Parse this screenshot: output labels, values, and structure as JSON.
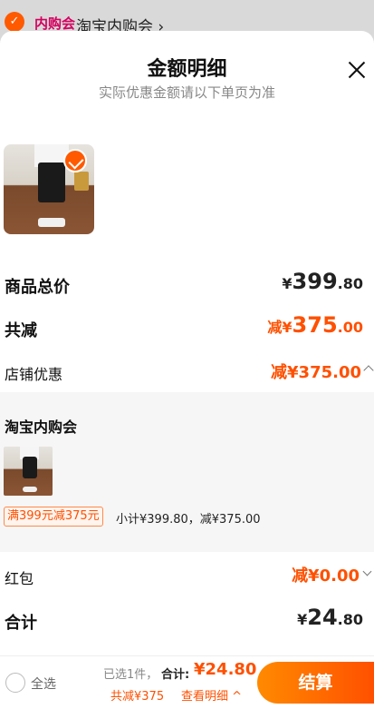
{
  "background": {
    "brand": "内购会",
    "store": "淘宝内购会 ›"
  },
  "sheet": {
    "title": "金额明细",
    "subtitle": "实际优惠金额请以下单页为准",
    "close_icon": "close-icon"
  },
  "summary": {
    "goods_total_label": "商品总价",
    "goods_total_yen": "¥",
    "goods_total_int": "399",
    "goods_total_dec": ".80",
    "total_reduce_label": "共减",
    "total_reduce_prefix": "减¥",
    "total_reduce_int": "375",
    "total_reduce_dec": ".00",
    "shop_discount_label": "店铺优惠",
    "shop_discount_value": "减¥375.00"
  },
  "shop": {
    "name": "淘宝内购会",
    "promo_tag": "满399元减375元",
    "subtotal": "小计¥399.80，减¥375.00"
  },
  "red_packet": {
    "label": "红包",
    "value": "减¥0.00"
  },
  "grand_total": {
    "label": "合计",
    "yen": "¥",
    "int": "24",
    "dec": ".80"
  },
  "bottom_bar": {
    "select_all": "全选",
    "selected_count": "已选1件，",
    "total_label": "合计:",
    "total_value": "¥24.80",
    "saved": "共减¥375",
    "view_detail": "查看明细 ^",
    "checkout": "结算"
  },
  "colors": {
    "accent": "#ff5000",
    "brand_pink": "#d4005f"
  }
}
